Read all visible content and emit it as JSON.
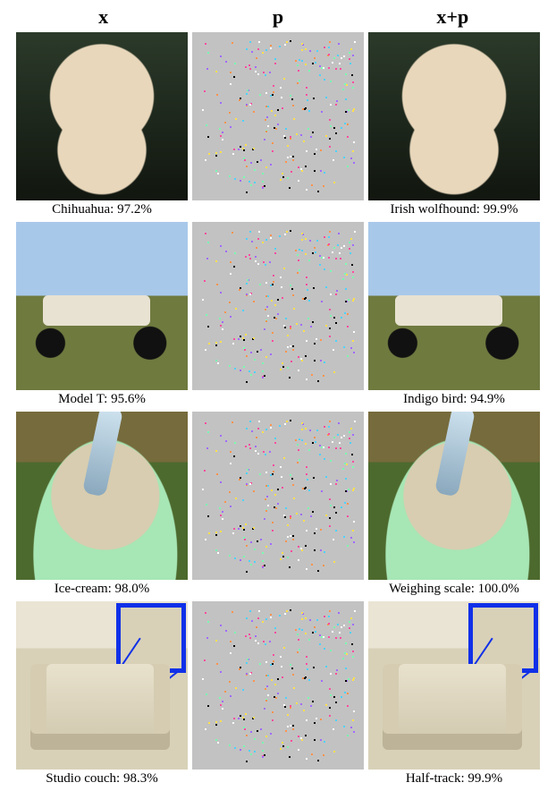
{
  "headers": {
    "col1": "x",
    "col2": "p",
    "col3": "x+p"
  },
  "rows": [
    {
      "orig": {
        "label": "Chihuahua",
        "confidence_pct": 97.2,
        "caption": "Chihuahua: 97.2%"
      },
      "perturbed": {
        "label": "Irish wolfhound",
        "confidence_pct": 99.9,
        "caption": "Irish wolfhound: 99.9%"
      },
      "mid_caption": ""
    },
    {
      "orig": {
        "label": "Model T",
        "confidence_pct": 95.6,
        "caption": "Model T: 95.6%"
      },
      "perturbed": {
        "label": "Indigo bird",
        "confidence_pct": 94.9,
        "caption": "Indigo bird: 94.9%"
      },
      "mid_caption": ""
    },
    {
      "orig": {
        "label": "Ice-cream",
        "confidence_pct": 98.0,
        "caption": "Ice-cream: 98.0%"
      },
      "perturbed": {
        "label": "Weighing scale",
        "confidence_pct": 100.0,
        "caption": "Weighing scale: 100.0%"
      },
      "mid_caption": ""
    },
    {
      "orig": {
        "label": "Studio couch",
        "confidence_pct": 98.3,
        "caption": "Studio couch: 98.3%",
        "has_zoom": true
      },
      "perturbed": {
        "label": "Half-track",
        "confidence_pct": 99.9,
        "caption": "Half-track: 99.9%",
        "has_zoom": true
      },
      "mid_caption": ""
    }
  ],
  "noise_colors": [
    "#ff4da0",
    "#4dd2ff",
    "#7affb0",
    "#ffe04d",
    "#ff934d",
    "#a06bff",
    "#ffffff",
    "#000000"
  ]
}
